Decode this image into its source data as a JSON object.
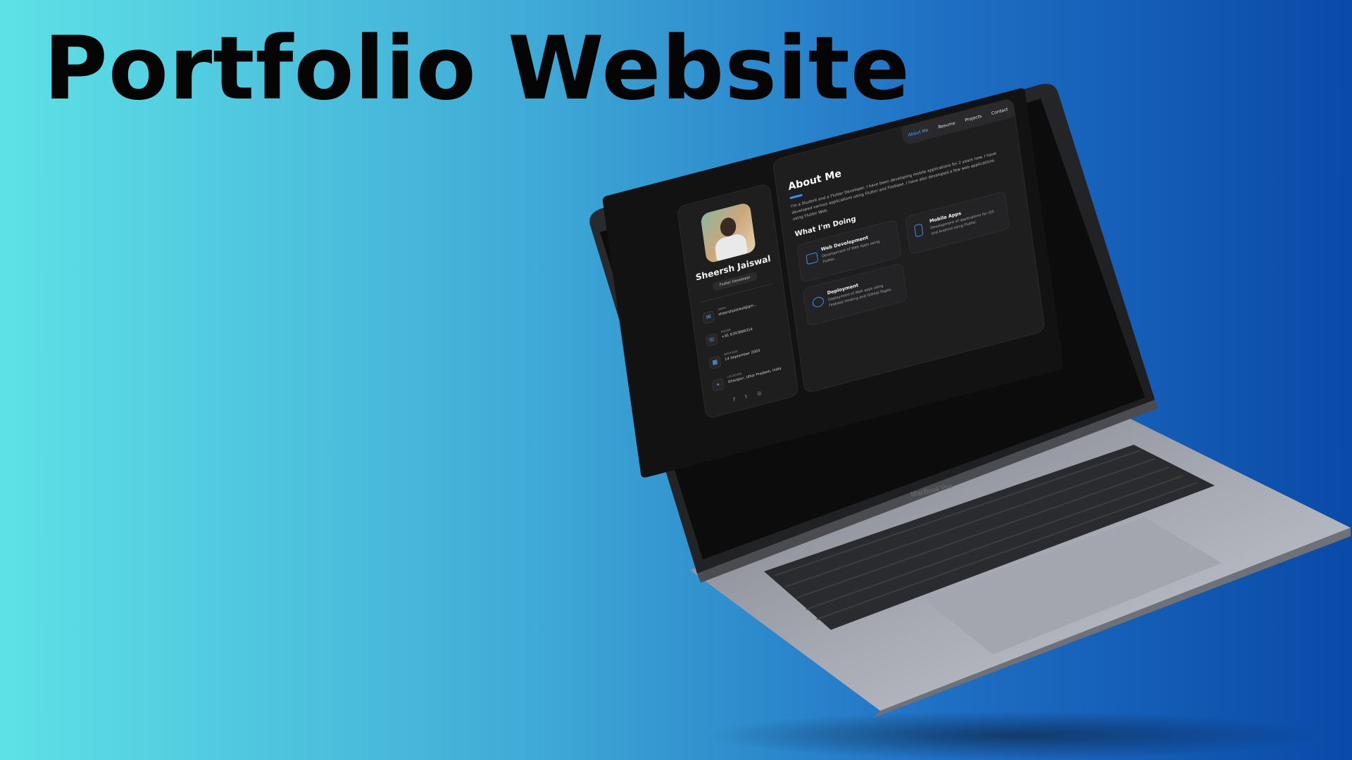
{
  "headline": "Portfolio Website",
  "device_label": "MacBook Pro",
  "portfolio": {
    "nav": [
      "About Me",
      "Resume",
      "Projects",
      "Contact"
    ],
    "profile": {
      "name": "Sheersh Jaiswal",
      "role": "Flutter Developer",
      "contacts": [
        {
          "label": "EMAIL",
          "value": "sheershjaiswal@gm...",
          "icon": "mail-icon",
          "glyph": "✉"
        },
        {
          "label": "PHONE",
          "value": "+91 6393889314",
          "icon": "phone-icon",
          "glyph": "☏"
        },
        {
          "label": "BIRTHDAY",
          "value": "14 September 2003",
          "icon": "calendar-icon",
          "glyph": "▦"
        },
        {
          "label": "LOCATION",
          "value": "Ghazipur, Uttar Pradesh, India",
          "icon": "location-pin-icon",
          "glyph": "⌖"
        }
      ],
      "socials": "f t ◎"
    },
    "about_title": "About Me",
    "about_text": "I'm a Student and a Flutter Developer. I have been developing mobile applications for 2 years now. I have developed various applications using Flutter and Firebase. I have also developed a few web applications using Flutter Web.",
    "doing_title": "What I'm Doing",
    "services": [
      {
        "title": "Web Development",
        "desc": "Development of Web Apps using Flutter."
      },
      {
        "title": "Mobile Apps",
        "desc": "Development of applications for iOS and Android using Flutter."
      },
      {
        "title": "Deployment",
        "desc": "Deployment of Web apps using Firebase Hosting and GitHub Pages."
      }
    ]
  },
  "colors": {
    "accent": "#3b8ef0",
    "screen_bg": "#121212",
    "card_bg": "#1e1e1f"
  }
}
